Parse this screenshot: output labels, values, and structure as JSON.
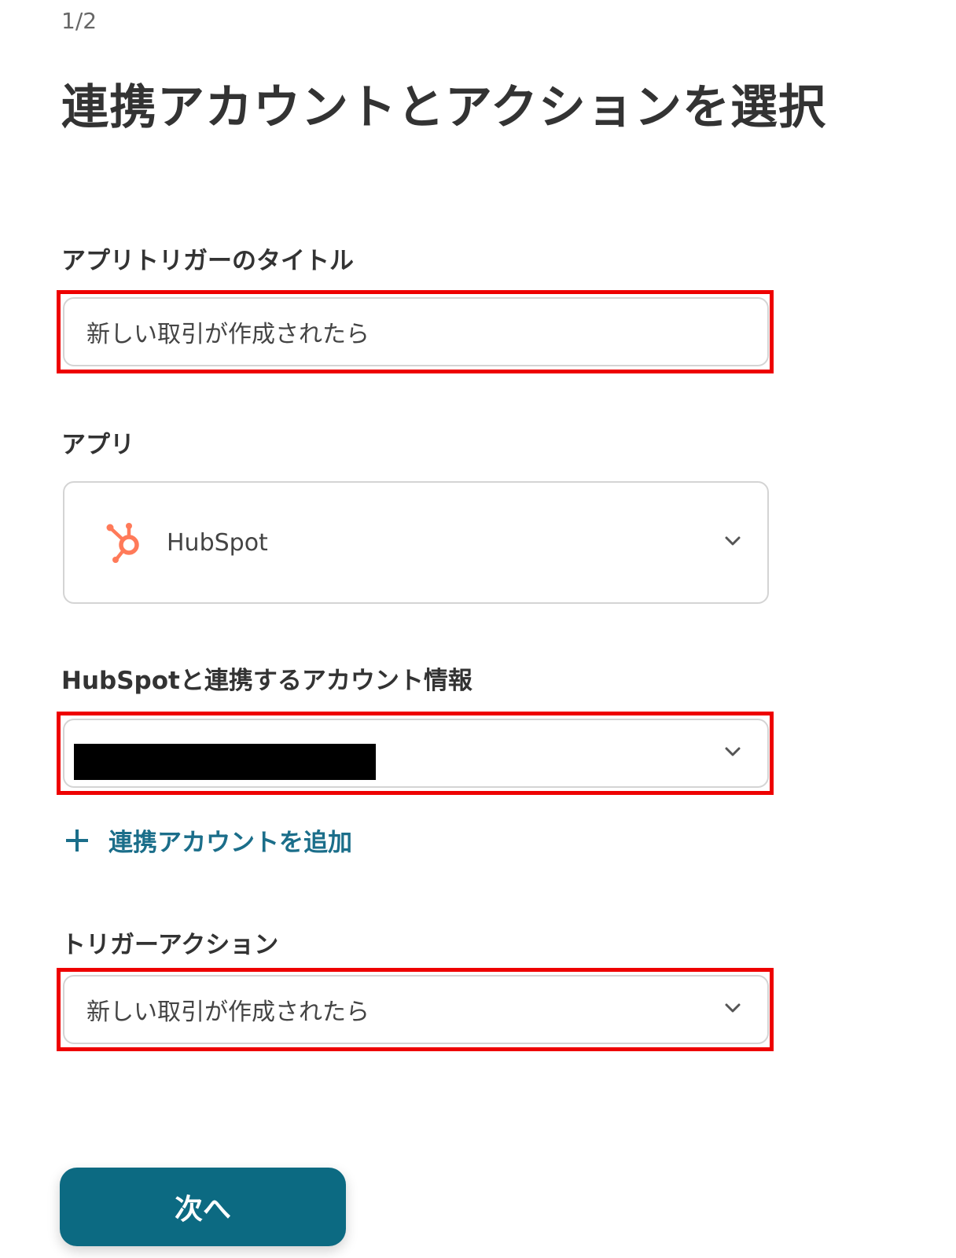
{
  "header": {
    "step": "1/2",
    "title": "連携アカウントとアクションを選択"
  },
  "trigger_title": {
    "label": "アプリトリガーのタイトル",
    "value": "新しい取引が作成されたら"
  },
  "app": {
    "label": "アプリ",
    "selected": "HubSpot",
    "icon": "hubspot-logo",
    "icon_color": "#ff7a59"
  },
  "account": {
    "label": "HubSpotと連携するアカウント情報",
    "value_redacted": true,
    "add_link": "連携アカウントを追加",
    "link_color": "#1b6e8a"
  },
  "trigger_action": {
    "label": "トリガーアクション",
    "value": "新しい取引が作成されたら"
  },
  "footer": {
    "next_button": "次へ",
    "button_color": "#0c6a82"
  },
  "highlight_color": "#ee0000"
}
